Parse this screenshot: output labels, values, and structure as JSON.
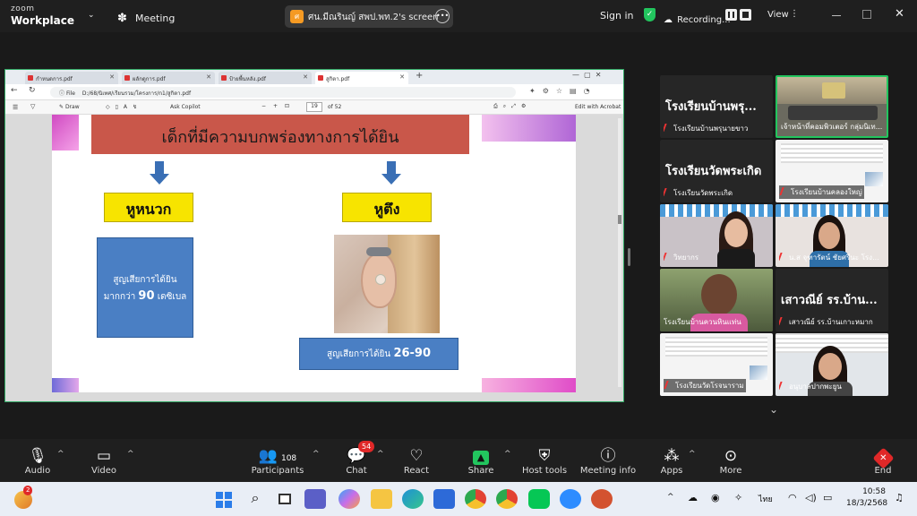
{
  "titlebar": {
    "logo_small": "zoom",
    "logo_big": "Workplace",
    "meeting_label": "Meeting",
    "share_pill": "ศน.มีณรินญ์ สพป.พท.2's screen",
    "share_pill_initial": "ศ",
    "signin": "Sign in",
    "recording": "Recording...",
    "view": "View"
  },
  "browser": {
    "tabs": [
      {
        "label": "กำหนดการ.pdf"
      },
      {
        "label": "ผลักดูการ.pdf"
      },
      {
        "label": "ป้ายพื้นหลัง.pdf"
      },
      {
        "label": "สูกิตา.pdf"
      }
    ],
    "address": "D:/68/นิเทศ/เรียนรวม/โครงการ/n1/สูกิตา.pdf",
    "file_label": "File",
    "pdf_draw": "Draw",
    "pdf_copilot": "Ask Copilot",
    "page_current": "19",
    "page_total": "of 52",
    "edit_acrobat": "Edit with Acrobat"
  },
  "slide": {
    "title": "เด็กที่มีความบกพร่องทางการได้ยิน",
    "left_label": "หูหนวก",
    "right_label": "หูตึง",
    "left_box_text": "สูญเสียการได้ยิน",
    "left_box_text2": "มากกว่า",
    "left_box_value": "90",
    "left_box_unit": "เดซิเบล",
    "right_box_text": "สูญเสียการได้ยิน",
    "right_box_value": "26-90"
  },
  "participants_panel": {
    "tiles": [
      {
        "big": "โรงเรียนบ้านพรุ...",
        "name": "โรงเรียนบ้านพรุนายขาว",
        "muted": true
      },
      {
        "big": "",
        "name": "เจ้าหน้าที่คอมพิวเตอร์ กลุ่มนิเท...",
        "muted": false
      },
      {
        "big": "โรงเรียนวัดพระเกิด",
        "name": "โรงเรียนวัดพระเกิด",
        "muted": true
      },
      {
        "big": "",
        "name": "โรงเรียนบ้านคลองใหญ่",
        "muted": true
      },
      {
        "big": "",
        "name": "วิทยากร",
        "muted": true
      },
      {
        "big": "",
        "name": "น.ส จุฑารัตน์ ชัยศรีนะ โรง...",
        "muted": true
      },
      {
        "big": "",
        "name": "โรงเรียนบ้านควนหินแท่น",
        "muted": false
      },
      {
        "big": "เสาวณีย์ รร.บ้าน...",
        "name": "เสาวณีย์ รร.บ้านเกาะหมาก",
        "muted": true
      },
      {
        "big": "",
        "name": "โรงเรียนวัดโรจนาราม",
        "muted": true
      },
      {
        "big": "",
        "name": "อนุบาลปากพะยูน",
        "muted": true
      }
    ]
  },
  "toolbar": {
    "audio": "Audio",
    "video": "Video",
    "participants": "Participants",
    "participants_count": "108",
    "chat": "Chat",
    "chat_badge": "54",
    "react": "React",
    "share": "Share",
    "host_tools": "Host tools",
    "meeting_info": "Meeting info",
    "apps": "Apps",
    "more": "More",
    "end": "End"
  },
  "taskbar": {
    "notification_badge": "2",
    "lang": "ไทย",
    "time": "10:58",
    "date": "18/3/2568"
  },
  "colors": {
    "accent_green": "#22c55e",
    "zoom_blue": "#0b5cff",
    "end_red": "#e02828",
    "slide_title_bg": "#c9574a",
    "slide_label_bg": "#f7e400",
    "slide_box_blue": "#4a7fc4"
  }
}
